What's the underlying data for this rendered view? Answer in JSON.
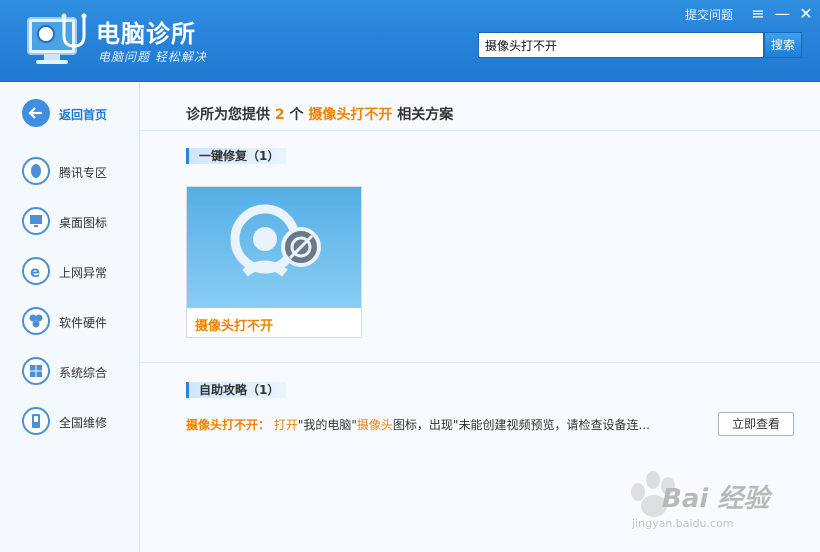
{
  "header": {
    "app_title": "电脑诊所",
    "app_slogan": "电脑问题 轻松解决",
    "submit_question": "提交问题",
    "search": {
      "value": "摄像头打不开",
      "button": "搜索"
    }
  },
  "sidebar": {
    "items": [
      {
        "label": "返回首页",
        "icon": "back-arrow-icon"
      },
      {
        "label": "腾讯专区",
        "icon": "qq-penguin-icon"
      },
      {
        "label": "桌面图标",
        "icon": "monitor-icon"
      },
      {
        "label": "上网异常",
        "icon": "ie-browser-icon"
      },
      {
        "label": "软件硬件",
        "icon": "hardware-icon"
      },
      {
        "label": "系统综合",
        "icon": "windows-icon"
      },
      {
        "label": "全国维修",
        "icon": "phone-icon"
      }
    ]
  },
  "main": {
    "summary": {
      "prefix": "诊所为您提供",
      "count": "2",
      "unit": "个",
      "keyword": "摄像头打不开",
      "suffix": "相关方案"
    },
    "one_click": {
      "tag": "一键修复（1）",
      "card_title": "摄像头打不开"
    },
    "guides": {
      "tag": "自助攻略（1）",
      "item_title": "摄像头打不开：",
      "text_1": "打开",
      "text_2": "\"我的电脑\"",
      "text_3": "摄像头",
      "text_4": "图标，出现\"未能创建视频预览，请检查设备连...",
      "button": "立即查看"
    }
  },
  "watermark": {
    "brand": "Bai 经验",
    "url": "jingyan.baidu.com"
  },
  "colors": {
    "accent": "#1f78d1",
    "highlight": "#f08300",
    "sidebar_bg": "#f4f9fd"
  }
}
